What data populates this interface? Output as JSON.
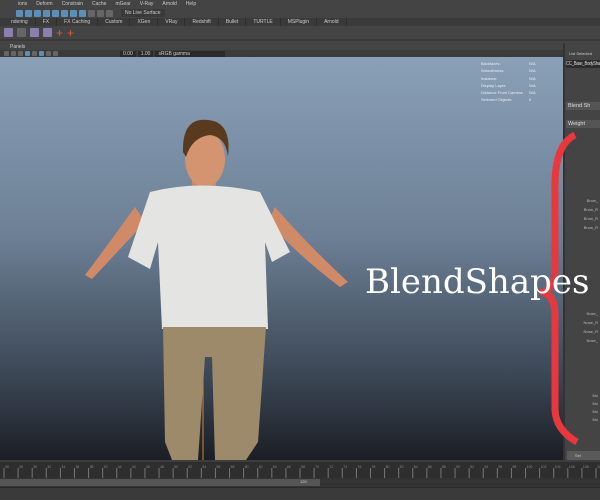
{
  "menubar": [
    "ions",
    "Deform",
    "Constrain",
    "Cache",
    "mGear",
    "V-Ray",
    "Arnold",
    "Help"
  ],
  "statusline": {
    "live_surface": "No Live Surface"
  },
  "shelf_tabs": [
    "ndering",
    "FX",
    "FX Caching",
    "Custom",
    "XGen",
    "VRay",
    "Redshift",
    "Bullet",
    "TURTLE",
    "MSPlugin",
    "Arnold"
  ],
  "panels_menu": [
    "Panels"
  ],
  "view_toolbar": {
    "value1": "0.00",
    "value2": "1.00",
    "color_space": "sRGB gamma"
  },
  "hud": [
    {
      "label": "Backfaces:",
      "value": "N/A"
    },
    {
      "label": "Smoothness:",
      "value": "N/A"
    },
    {
      "label": "Instance:",
      "value": "N/A"
    },
    {
      "label": "Display Layer:",
      "value": "N/A"
    },
    {
      "label": "Distance From Camera:",
      "value": "N/A"
    },
    {
      "label": "Selected Objects:",
      "value": "0"
    }
  ],
  "right_panel": {
    "tabs": [
      "List",
      "Selected"
    ],
    "node": "CC_Base_BodySha",
    "section1": "Blend Sh",
    "section2": "Weight",
    "items": [
      "Brow_",
      "Brow_R",
      "Brow_R",
      "Brow_R",
      "Nose_",
      "Nose_R",
      "Nose_R",
      "Nose_",
      "Mo",
      "Mo",
      "Mo",
      "Mo"
    ],
    "button": "Sel"
  },
  "annotation": {
    "label": "BlendShapes",
    "color": "#e8383d"
  },
  "timeline": {
    "start": 26,
    "end": 110,
    "step": 2
  },
  "range": {
    "end": "120"
  }
}
